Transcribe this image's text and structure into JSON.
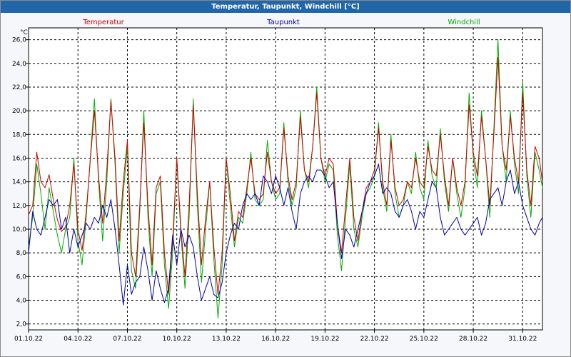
{
  "window": {
    "title": "Temperatur, Taupunkt, Windchill [°C]"
  },
  "chart_data": {
    "type": "line",
    "title": "Temperatur, Taupunkt, Windchill [°C]",
    "ylabel": "°C",
    "ylim": [
      1.5,
      27.0
    ],
    "xlim": [
      0,
      31.2
    ],
    "yticks": [
      2.0,
      4.0,
      6.0,
      8.0,
      10.0,
      12.0,
      14.0,
      16.0,
      18.0,
      20.0,
      22.0,
      24.0,
      26.0
    ],
    "ytick_labels": [
      "2,0",
      "4,0",
      "6,0",
      "8,0",
      "10,0",
      "12,0",
      "14,0",
      "16,0",
      "18,0",
      "20,0",
      "22,0",
      "24,0",
      "26,0"
    ],
    "xticks": [
      0,
      3,
      6,
      9,
      12,
      15,
      18,
      21,
      24,
      27,
      30
    ],
    "xtick_labels": [
      "01.10.22",
      "04.10.22",
      "07.10.22",
      "10.10.22",
      "13.10.22",
      "16.10.22",
      "19.10.22",
      "22.10.22",
      "25.10.22",
      "28.10.22",
      "31.10.22"
    ],
    "grid": true,
    "legend": "top",
    "series": [
      {
        "name": "Temperatur",
        "color": "#cc0000",
        "x": [
          0,
          0.25,
          0.5,
          0.75,
          1,
          1.25,
          1.5,
          1.75,
          2,
          2.25,
          2.5,
          2.75,
          3,
          3.25,
          3.5,
          3.75,
          4,
          4.25,
          4.5,
          4.75,
          5,
          5.25,
          5.5,
          5.75,
          6,
          6.25,
          6.5,
          6.75,
          7,
          7.25,
          7.5,
          7.75,
          8,
          8.25,
          8.5,
          8.75,
          9,
          9.25,
          9.5,
          9.75,
          10,
          10.25,
          10.5,
          10.75,
          11,
          11.25,
          11.5,
          11.75,
          12,
          12.25,
          12.5,
          12.75,
          13,
          13.25,
          13.5,
          13.75,
          14,
          14.25,
          14.5,
          14.75,
          15,
          15.25,
          15.5,
          15.75,
          16,
          16.25,
          16.5,
          16.75,
          17,
          17.25,
          17.5,
          17.75,
          18,
          18.25,
          18.5,
          18.75,
          19,
          19.25,
          19.5,
          19.75,
          20,
          20.25,
          20.5,
          20.75,
          21,
          21.25,
          21.5,
          21.75,
          22,
          22.25,
          22.5,
          22.75,
          23,
          23.25,
          23.5,
          23.75,
          24,
          24.25,
          24.5,
          24.75,
          25,
          25.25,
          25.5,
          25.75,
          26,
          26.25,
          26.5,
          26.75,
          27,
          27.25,
          27.5,
          27.75,
          28,
          28.25,
          28.5,
          28.75,
          29,
          29.25,
          29.5,
          29.75,
          30,
          30.25,
          30.5,
          30.75,
          31,
          31.2
        ],
        "values": [
          11.2,
          12.0,
          16.5,
          14.0,
          13.5,
          14.6,
          12.5,
          10.8,
          9.8,
          10.2,
          12.0,
          15.5,
          10.0,
          8.2,
          11.5,
          15.8,
          20.0,
          14.5,
          10.5,
          15.0,
          20.8,
          16.0,
          9.0,
          14.0,
          17.5,
          8.0,
          6.0,
          12.0,
          19.0,
          12.0,
          7.0,
          13.5,
          14.5,
          8.0,
          4.5,
          9.0,
          16.0,
          10.0,
          6.0,
          12.0,
          20.5,
          13.0,
          7.0,
          11.0,
          14.0,
          8.5,
          4.5,
          8.0,
          16.0,
          13.0,
          9.0,
          11.5,
          11.0,
          13.5,
          16.0,
          13.0,
          12.5,
          13.0,
          16.5,
          14.0,
          13.0,
          13.5,
          18.5,
          14.5,
          12.5,
          14.0,
          19.5,
          15.0,
          14.0,
          17.0,
          21.5,
          16.0,
          14.5,
          16.0,
          15.5,
          10.5,
          8.0,
          12.0,
          16.0,
          11.0,
          9.0,
          11.5,
          13.5,
          14.0,
          15.0,
          18.5,
          14.0,
          12.0,
          17.5,
          13.5,
          12.0,
          12.5,
          14.0,
          13.5,
          16.0,
          14.0,
          13.5,
          17.0,
          15.0,
          14.5,
          18.0,
          14.5,
          12.0,
          16.0,
          13.5,
          12.0,
          14.0,
          20.5,
          16.5,
          14.5,
          19.5,
          16.0,
          12.0,
          18.0,
          24.5,
          17.0,
          15.0,
          19.5,
          16.0,
          14.0,
          21.5,
          15.0,
          12.0,
          17.0,
          16.0,
          14.0
        ]
      },
      {
        "name": "Taupunkt",
        "color": "#0000aa",
        "x": [
          0,
          0.25,
          0.5,
          0.75,
          1,
          1.25,
          1.5,
          1.75,
          2,
          2.25,
          2.5,
          2.75,
          3,
          3.25,
          3.5,
          3.75,
          4,
          4.25,
          4.5,
          4.75,
          5,
          5.25,
          5.5,
          5.75,
          6,
          6.25,
          6.5,
          6.75,
          7,
          7.25,
          7.5,
          7.75,
          8,
          8.25,
          8.5,
          8.75,
          9,
          9.25,
          9.5,
          9.75,
          10,
          10.25,
          10.5,
          10.75,
          11,
          11.25,
          11.5,
          11.75,
          12,
          12.25,
          12.5,
          12.75,
          13,
          13.25,
          13.5,
          13.75,
          14,
          14.25,
          14.5,
          14.75,
          15,
          15.25,
          15.5,
          15.75,
          16,
          16.25,
          16.5,
          16.75,
          17,
          17.25,
          17.5,
          17.75,
          18,
          18.25,
          18.5,
          18.75,
          19,
          19.25,
          19.5,
          19.75,
          20,
          20.25,
          20.5,
          20.75,
          21,
          21.25,
          21.5,
          21.75,
          22,
          22.25,
          22.5,
          22.75,
          23,
          23.25,
          23.5,
          23.75,
          24,
          24.25,
          24.5,
          24.75,
          25,
          25.25,
          25.5,
          25.75,
          26,
          26.25,
          26.5,
          26.75,
          27,
          27.25,
          27.5,
          27.75,
          28,
          28.25,
          28.5,
          28.75,
          29,
          29.25,
          29.5,
          29.75,
          30,
          30.25,
          30.5,
          30.75,
          31,
          31.2
        ],
        "values": [
          8.0,
          11.5,
          10.0,
          9.5,
          11.0,
          12.5,
          12.0,
          12.5,
          10.0,
          11.0,
          8.0,
          10.0,
          8.5,
          9.5,
          10.5,
          10.0,
          11.0,
          10.5,
          12.0,
          11.0,
          12.5,
          10.0,
          7.0,
          3.6,
          7.0,
          4.5,
          5.5,
          6.0,
          8.5,
          6.5,
          4.0,
          6.5,
          5.0,
          3.8,
          5.0,
          9.5,
          7.0,
          10.0,
          8.5,
          9.5,
          8.5,
          6.0,
          4.0,
          5.0,
          6.0,
          4.5,
          4.2,
          5.5,
          8.0,
          9.5,
          10.5,
          10.0,
          12.0,
          13.0,
          12.5,
          13.0,
          12.0,
          14.5,
          14.0,
          13.0,
          14.5,
          13.5,
          12.0,
          13.5,
          11.5,
          10.0,
          13.0,
          14.0,
          14.5,
          14.0,
          15.0,
          15.0,
          14.5,
          13.5,
          14.0,
          10.5,
          7.5,
          10.0,
          9.5,
          8.5,
          10.0,
          11.5,
          13.0,
          14.0,
          14.5,
          15.5,
          13.0,
          13.5,
          13.0,
          11.5,
          11.0,
          12.0,
          12.5,
          11.5,
          10.0,
          11.5,
          11.0,
          12.5,
          14.0,
          13.5,
          11.0,
          9.5,
          10.0,
          10.5,
          11.0,
          10.0,
          9.5,
          10.0,
          10.5,
          11.0,
          9.5,
          10.5,
          12.5,
          13.0,
          13.5,
          12.0,
          14.0,
          15.0,
          13.0,
          14.0,
          12.0,
          11.0,
          10.0,
          9.5,
          10.5,
          11.0
        ]
      },
      {
        "name": "Windchill",
        "color": "#00aa00",
        "x": [
          0,
          0.25,
          0.5,
          0.75,
          1,
          1.25,
          1.5,
          1.75,
          2,
          2.25,
          2.5,
          2.75,
          3,
          3.25,
          3.5,
          3.75,
          4,
          4.25,
          4.5,
          4.75,
          5,
          5.25,
          5.5,
          5.75,
          6,
          6.25,
          6.5,
          6.75,
          7,
          7.25,
          7.5,
          7.75,
          8,
          8.25,
          8.5,
          8.75,
          9,
          9.25,
          9.5,
          9.75,
          10,
          10.25,
          10.5,
          10.75,
          11,
          11.25,
          11.5,
          11.75,
          12,
          12.25,
          12.5,
          12.75,
          13,
          13.25,
          13.5,
          13.75,
          14,
          14.25,
          14.5,
          14.75,
          15,
          15.25,
          15.5,
          15.75,
          16,
          16.25,
          16.5,
          16.75,
          17,
          17.25,
          17.5,
          17.75,
          18,
          18.25,
          18.5,
          18.75,
          19,
          19.25,
          19.5,
          19.75,
          20,
          20.25,
          20.5,
          20.75,
          21,
          21.25,
          21.5,
          21.75,
          22,
          22.25,
          22.5,
          22.75,
          23,
          23.25,
          23.5,
          23.75,
          24,
          24.25,
          24.5,
          24.75,
          25,
          25.25,
          25.5,
          25.75,
          26,
          26.25,
          26.5,
          26.75,
          27,
          27.25,
          27.5,
          27.75,
          28,
          28.25,
          28.5,
          28.75,
          29,
          29.25,
          29.5,
          29.75,
          30,
          30.25,
          30.5,
          30.75,
          31,
          31.2
        ],
        "values": [
          8.5,
          11.0,
          15.5,
          13.0,
          10.0,
          13.5,
          11.5,
          9.5,
          8.0,
          10.0,
          11.0,
          16.0,
          9.0,
          7.0,
          11.0,
          16.0,
          21.0,
          14.0,
          9.0,
          14.0,
          21.0,
          15.5,
          8.0,
          13.0,
          17.0,
          6.5,
          5.0,
          11.5,
          20.0,
          11.0,
          6.0,
          13.0,
          14.0,
          7.0,
          3.3,
          8.0,
          16.0,
          9.5,
          5.0,
          11.0,
          21.0,
          12.0,
          5.5,
          10.0,
          14.0,
          7.5,
          2.5,
          7.0,
          16.0,
          12.0,
          8.5,
          11.0,
          10.5,
          13.0,
          16.5,
          12.5,
          12.0,
          12.5,
          17.5,
          14.0,
          12.5,
          13.0,
          19.0,
          14.0,
          12.0,
          13.5,
          20.0,
          15.0,
          13.5,
          17.0,
          22.0,
          16.0,
          14.0,
          15.5,
          15.0,
          9.5,
          6.5,
          11.0,
          15.5,
          10.0,
          8.5,
          11.0,
          13.0,
          13.5,
          14.5,
          19.0,
          13.5,
          11.5,
          18.0,
          13.0,
          11.0,
          12.0,
          14.0,
          13.0,
          16.5,
          13.5,
          12.5,
          17.5,
          14.5,
          13.5,
          18.5,
          14.0,
          11.5,
          16.0,
          13.0,
          11.0,
          13.5,
          21.5,
          16.0,
          13.5,
          20.0,
          16.0,
          11.0,
          18.5,
          26.0,
          17.0,
          14.0,
          20.0,
          15.5,
          13.0,
          22.5,
          14.5,
          11.0,
          16.5,
          15.0,
          13.5
        ]
      }
    ]
  }
}
